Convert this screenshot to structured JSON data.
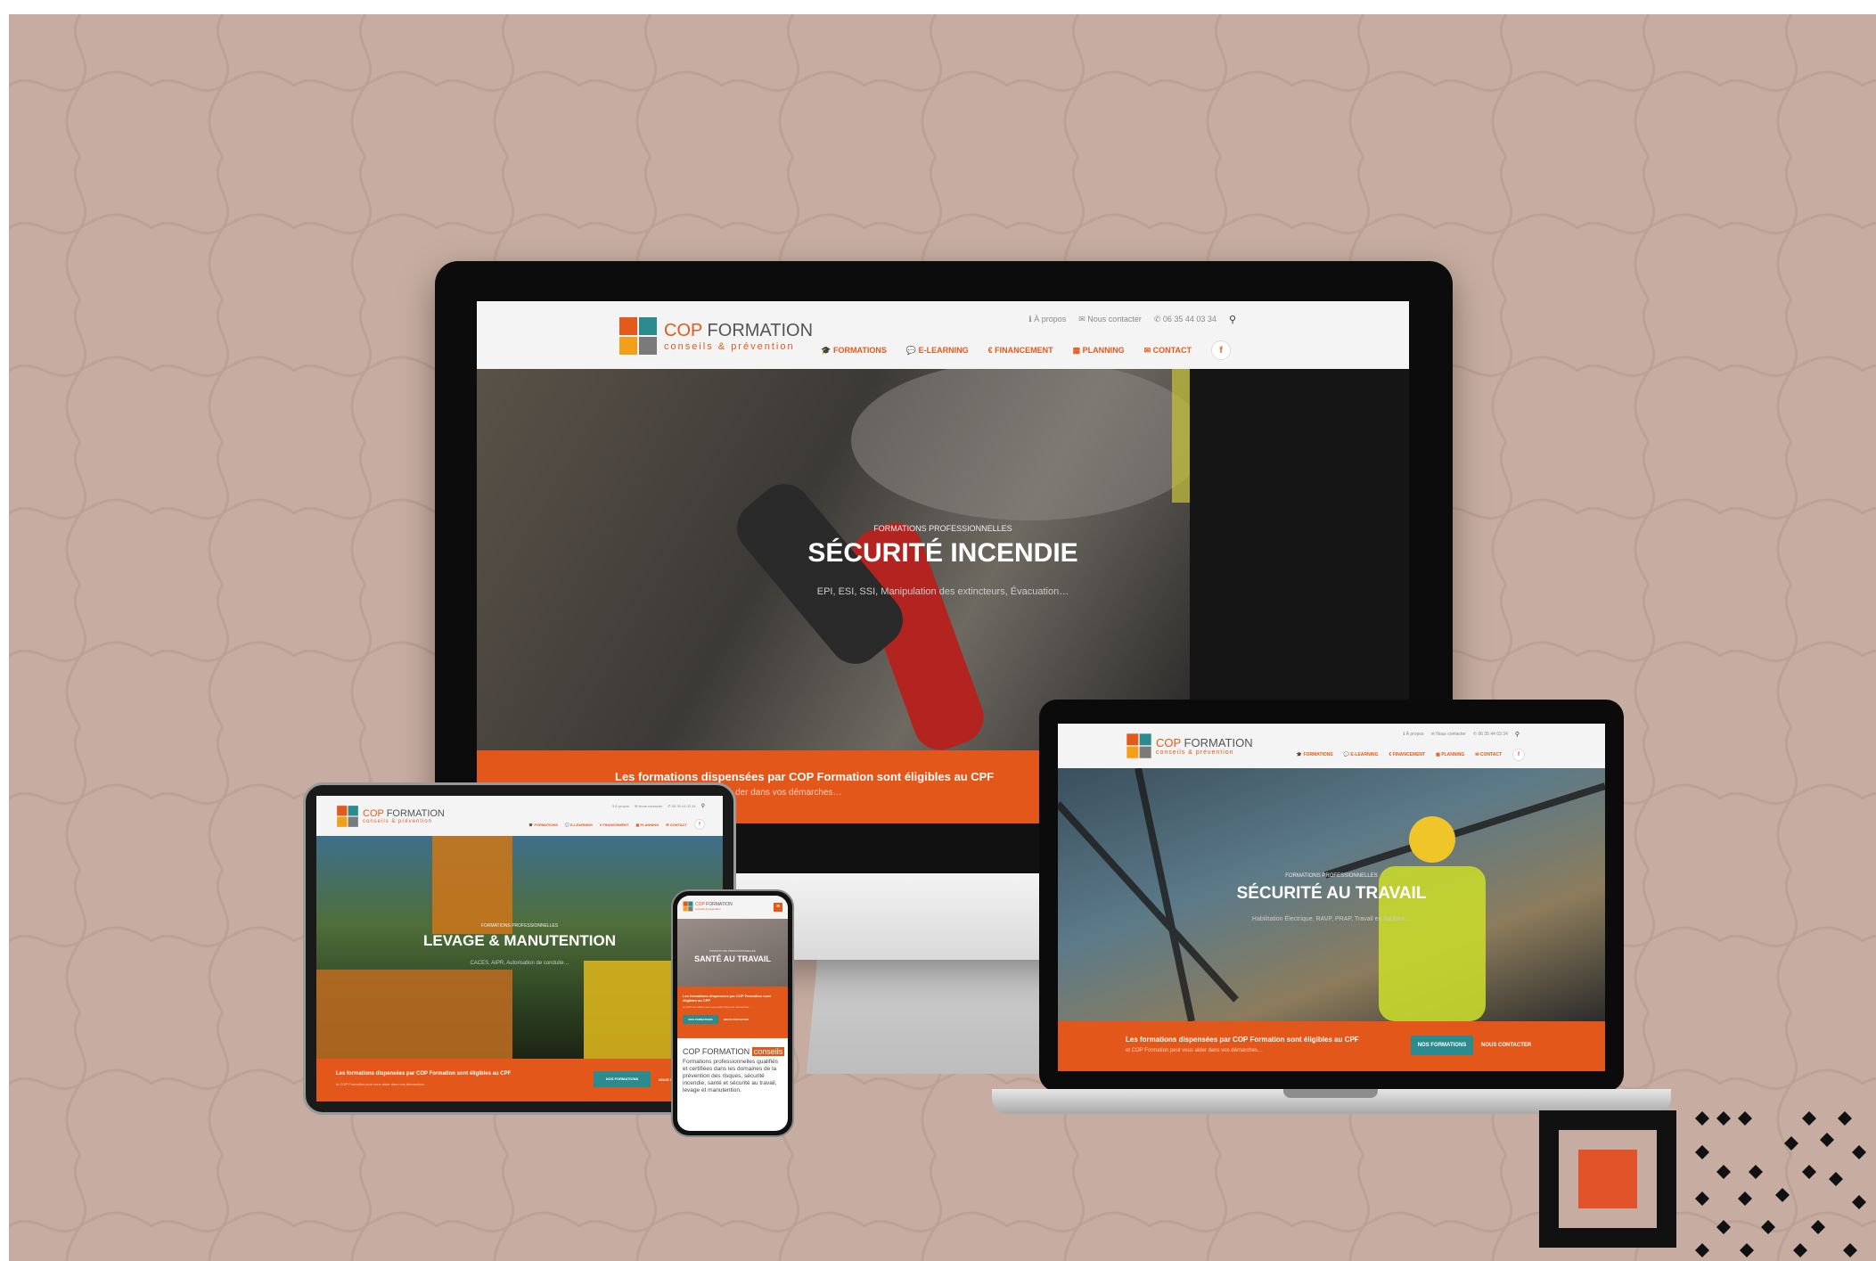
{
  "brand": {
    "name_accent": "COP",
    "name_rest": " FORMATION",
    "tagline": "conseils & prévention"
  },
  "top_links": {
    "about": "À propos",
    "contact_us": "Nous contacter",
    "phone": "06 35 44 03 34"
  },
  "nav": {
    "formations": "FORMATIONS",
    "elearning": "E-LEARNING",
    "financement": "FINANCEMENT",
    "planning": "PLANNING",
    "contact": "CONTACT",
    "facebook": "f"
  },
  "imac": {
    "kicker": "FORMATIONS PROFESSIONNELLES",
    "title": "SÉCURITÉ INCENDIE",
    "desc": "EPI, ESI, SSI, Manipulation des extincteurs, Évacuation…",
    "band_title": "Les formations dispensées par COP Formation sont éligibles au CPF",
    "band_text": "…der dans vos démarches…"
  },
  "laptop": {
    "kicker": "FORMATIONS PROFESSIONNELLES",
    "title": "SÉCURITÉ AU TRAVAIL",
    "desc": "Habilitation Électrique, RAVP, PRAP, Travail en hauteur…",
    "band_title": "Les formations dispensées par COP Formation sont éligibles au CPF",
    "band_text": "et COP Formation peut vous aider dans vos démarches…",
    "btn_primary": "NOS FORMATIONS",
    "btn_secondary": "NOUS CONTACTER"
  },
  "tablet": {
    "kicker": "FORMATIONS PROFESSIONNELLES",
    "title": "LEVAGE & MANUTENTION",
    "desc": "CACES, AIPR, Autorisation de conduite…",
    "band_title": "Les formations dispensées par COP Formation sont éligibles au CPF",
    "band_text": "et COP Formation peut vous aider dans vos démarches…",
    "btn_primary": "NOS FORMATIONS",
    "btn_secondary": "NOUS CONTACTER"
  },
  "phone": {
    "kicker": "FORMATIONS PROFESSIONNELLES",
    "title": "SANTÉ AU TRAVAIL",
    "band_title": "Les formations dispensées par COP Formation sont éligibles au CPF",
    "band_text": "et COP Formation peut vous aider dans vos démarches…",
    "btn_primary": "NOS FORMATIONS",
    "btn_secondary": "NOUS CONTACTER",
    "section_name": "COP FORMATION",
    "section_badge": "conseils",
    "section_text": "Formations professionnelles qualifiés et certifiées dans les domaines de la prévention des risques, sécurité incendie, santé et sécurité au travail, levage et manutention."
  },
  "colors": {
    "accent": "#e4571a",
    "teal": "#2b8b8e",
    "background": "#c7ada1"
  },
  "icons": {
    "info": "info-icon",
    "mail": "mail-icon",
    "phone": "phone-icon",
    "search": "search-icon",
    "graduation": "graduation-cap-icon",
    "chat": "chat-icon",
    "euro": "euro-icon",
    "calendar": "calendar-icon",
    "envelope": "envelope-icon"
  }
}
